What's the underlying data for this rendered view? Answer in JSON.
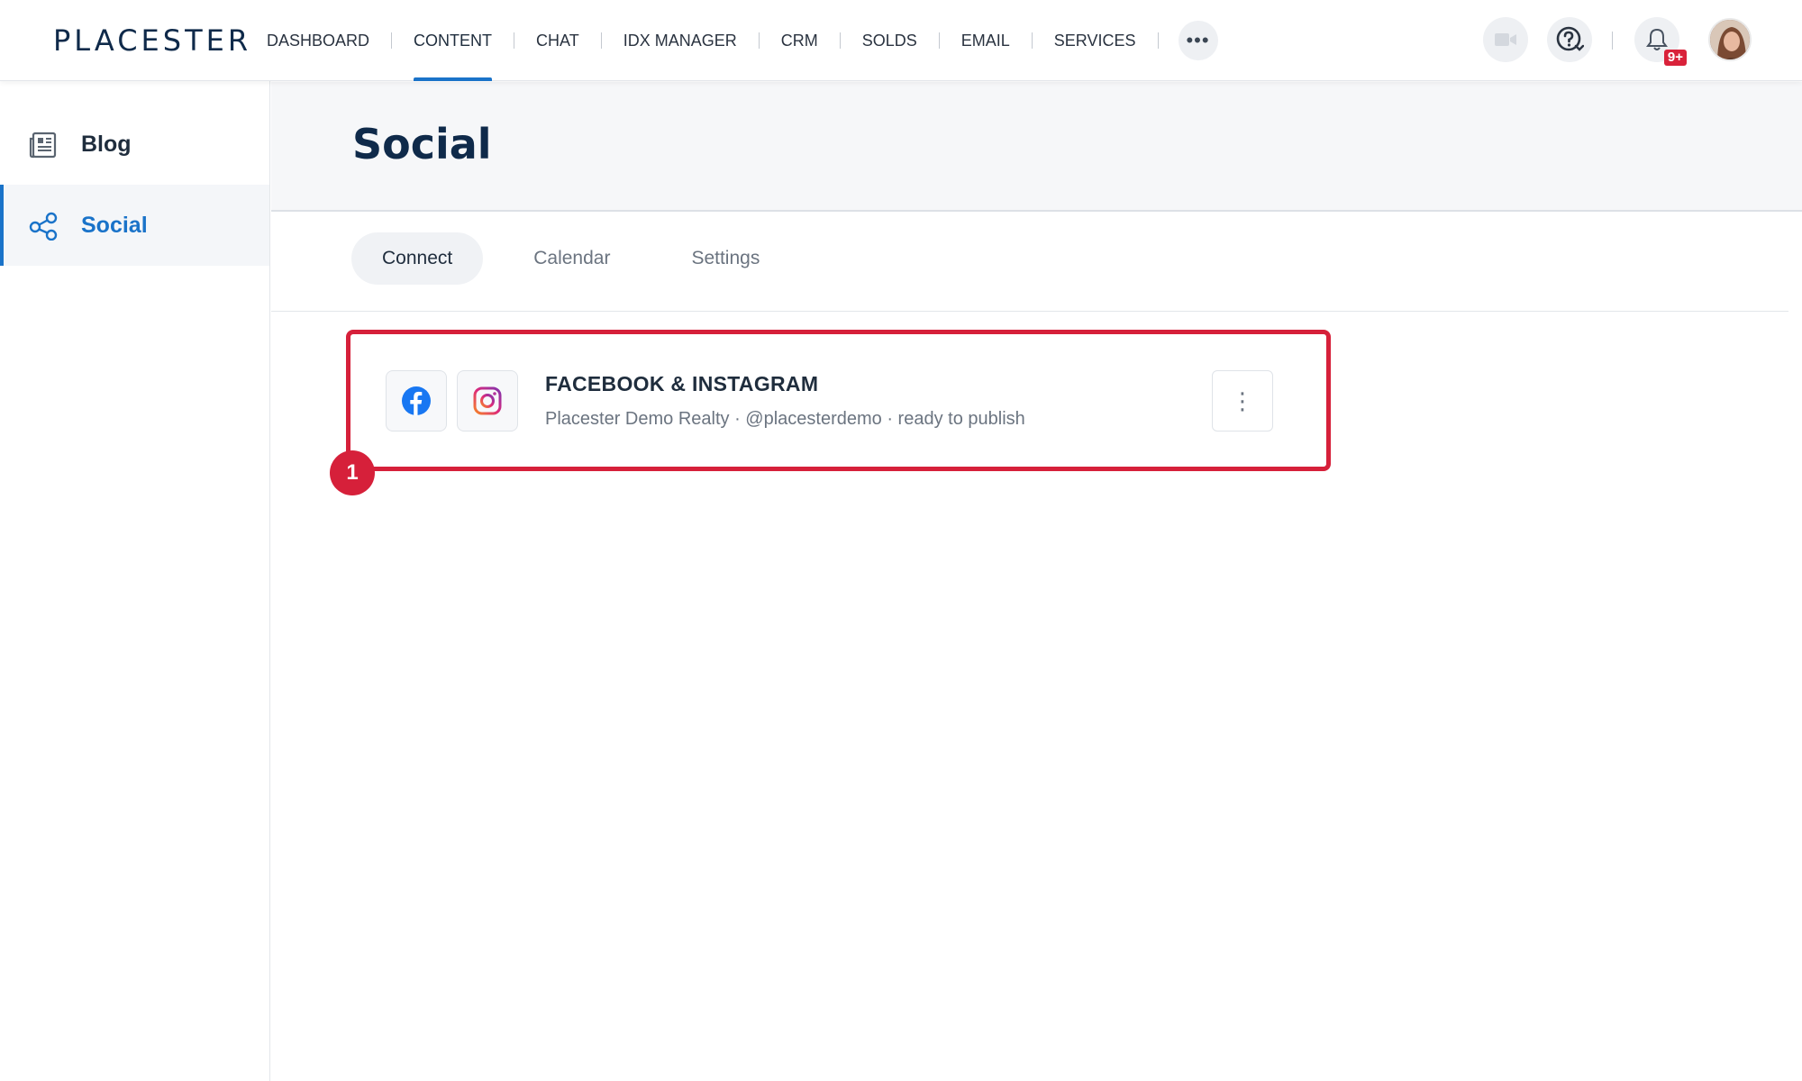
{
  "brand": {
    "logo": "PLACESTER"
  },
  "nav": {
    "items": [
      {
        "label": "DASHBOARD"
      },
      {
        "label": "CONTENT"
      },
      {
        "label": "CHAT"
      },
      {
        "label": "IDX MANAGER"
      },
      {
        "label": "CRM"
      },
      {
        "label": "SOLDS"
      },
      {
        "label": "EMAIL"
      },
      {
        "label": "SERVICES"
      }
    ],
    "active": "CONTENT",
    "more_label": "•••"
  },
  "top_right": {
    "notifications_badge": "9+",
    "icons": [
      "video-icon",
      "help-icon",
      "bell-icon",
      "avatar"
    ]
  },
  "sidebar": {
    "items": [
      {
        "label": "Blog",
        "icon": "newspaper-icon"
      },
      {
        "label": "Social",
        "icon": "share-icon"
      }
    ],
    "active": "Social"
  },
  "page": {
    "title": "Social"
  },
  "tabs": [
    {
      "label": "Connect"
    },
    {
      "label": "Calendar"
    },
    {
      "label": "Settings"
    }
  ],
  "active_tab": "Connect",
  "card": {
    "title": "FACEBOOK & INSTAGRAM",
    "subtitle": "Placester Demo Realty · @placesterdemo · ready to publish",
    "menu_label": "⋮"
  },
  "annotation": {
    "step": "1",
    "color": "#d6203a"
  },
  "colors": {
    "accent": "#1a73c9",
    "title": "#0f2a4a",
    "facebook": "#1877f2",
    "instagram": "#d6249f"
  }
}
